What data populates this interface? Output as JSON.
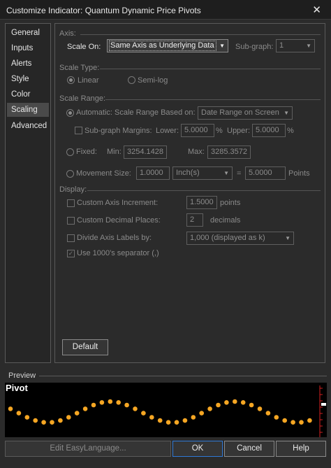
{
  "window": {
    "title": "Customize Indicator: Quantum Dynamic Price Pivots",
    "close_glyph": "✕"
  },
  "sidebar": {
    "items": [
      {
        "label": "General"
      },
      {
        "label": "Inputs"
      },
      {
        "label": "Alerts"
      },
      {
        "label": "Style"
      },
      {
        "label": "Color"
      },
      {
        "label": "Scaling",
        "active": true
      },
      {
        "label": "Advanced"
      }
    ]
  },
  "axis": {
    "section": "Axis:",
    "scale_on_label": "Scale On:",
    "scale_on_value": "Same Axis as Underlying Data",
    "subgraph_label": "Sub-graph:",
    "subgraph_value": "1"
  },
  "scale_type": {
    "section": "Scale Type:",
    "linear_label": "Linear",
    "semilog_label": "Semi-log",
    "selected": "Linear"
  },
  "scale_range": {
    "section": "Scale Range:",
    "automatic_label": "Automatic: Scale Range Based on:",
    "automatic_value": "Date Range on Screen",
    "subgraph_margins_label": "Sub-graph Margins:",
    "lower_label": "Lower:",
    "lower_value": "5.0000",
    "lower_unit": "%",
    "upper_label": "Upper:",
    "upper_value": "5.0000",
    "upper_unit": "%",
    "fixed_label": "Fixed:",
    "min_label": "Min:",
    "min_value": "3254.1428",
    "max_label": "Max:",
    "max_value": "3285.3572",
    "movement_label": "Movement Size:",
    "movement_value": "1.0000",
    "movement_unit_value": "Inch(s)",
    "equals": "=",
    "points_value": "5.0000",
    "points_label": "Points"
  },
  "display": {
    "section": "Display:",
    "custom_increment_label": "Custom Axis Increment:",
    "custom_increment_value": "1.5000",
    "custom_increment_unit": "points",
    "custom_decimal_label": "Custom Decimal Places:",
    "custom_decimal_value": "2",
    "custom_decimal_unit": "decimals",
    "divide_label": "Divide Axis Labels by:",
    "divide_value": "1,000 (displayed as k)",
    "separator_label": "Use 1000's separator (,)"
  },
  "default_button": "Default",
  "preview": {
    "label": "Preview",
    "title": "Pivot",
    "dot_color": "#f5a623",
    "marker_color": "#d42020"
  },
  "footer": {
    "edit_label": "Edit EasyLanguage...",
    "ok_label": "OK",
    "cancel_label": "Cancel",
    "help_label": "Help"
  },
  "icons": {
    "dropdown": "chevron-down-icon",
    "close": "close-icon"
  }
}
